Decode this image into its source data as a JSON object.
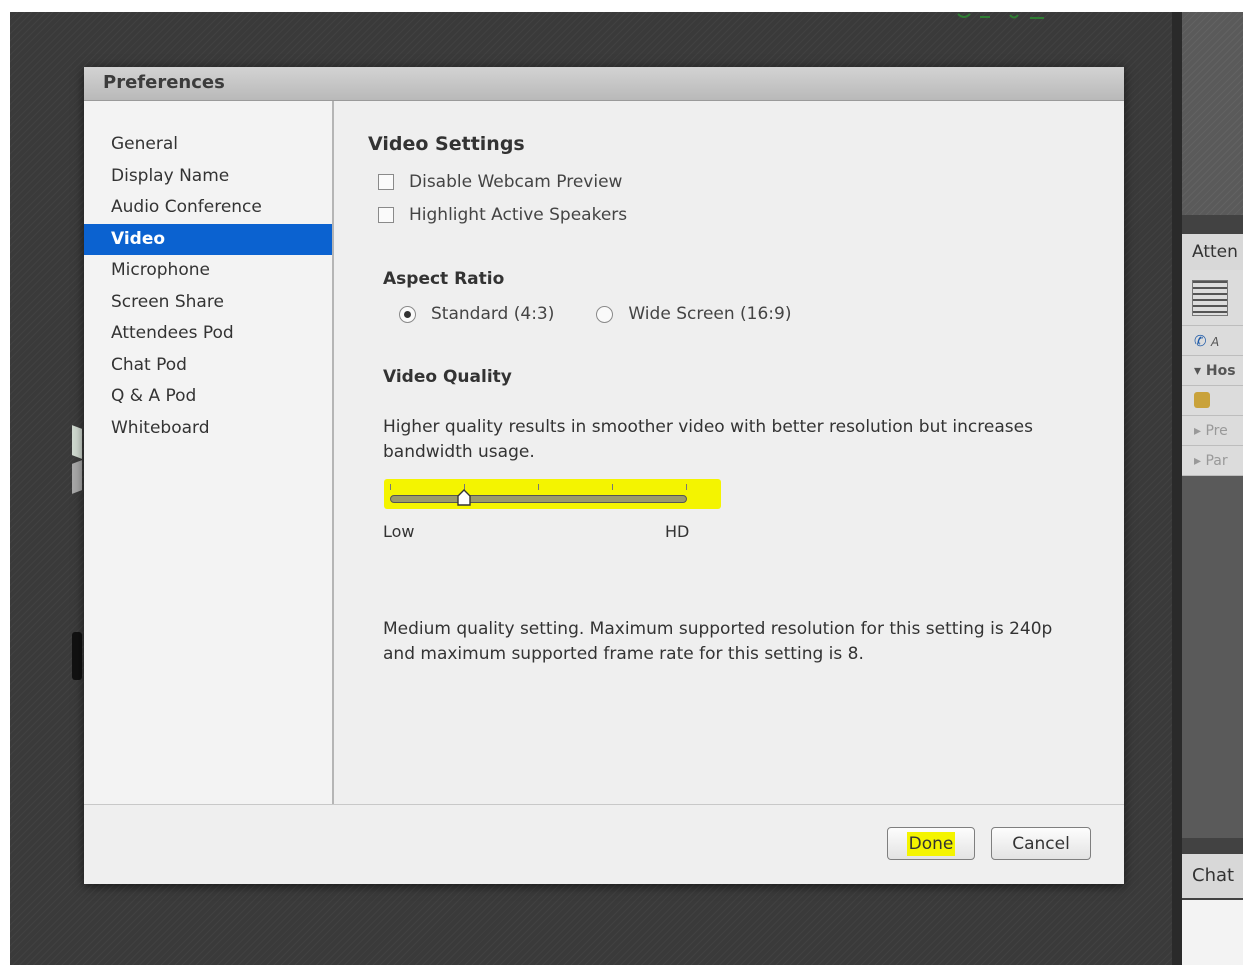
{
  "dialog": {
    "title": "Preferences"
  },
  "sidebar": {
    "items": [
      {
        "label": "General",
        "active": false
      },
      {
        "label": "Display Name",
        "active": false
      },
      {
        "label": "Audio Conference",
        "active": false
      },
      {
        "label": "Video",
        "active": true
      },
      {
        "label": "Microphone",
        "active": false
      },
      {
        "label": "Screen Share",
        "active": false
      },
      {
        "label": "Attendees Pod",
        "active": false
      },
      {
        "label": "Chat Pod",
        "active": false
      },
      {
        "label": "Q & A Pod",
        "active": false
      },
      {
        "label": "Whiteboard",
        "active": false
      }
    ]
  },
  "video_settings": {
    "heading": "Video Settings",
    "checkboxes": [
      {
        "label": "Disable Webcam Preview",
        "checked": false
      },
      {
        "label": "Highlight Active Speakers",
        "checked": false
      }
    ],
    "aspect_ratio": {
      "heading": "Aspect Ratio",
      "options": [
        {
          "label": "Standard (4:3)",
          "selected": true
        },
        {
          "label": "Wide Screen (16:9)",
          "selected": false
        }
      ]
    },
    "video_quality": {
      "heading": "Video Quality",
      "description": "Higher quality results in smoother video with better resolution but increases bandwidth usage.",
      "slider": {
        "min_label": "Low",
        "max_label": "HD",
        "steps": 5,
        "value_index": 1
      },
      "status": "Medium quality setting. Maximum supported resolution for this setting is 240p and maximum supported frame rate for this setting is 8."
    }
  },
  "footer": {
    "done_label": "Done",
    "cancel_label": "Cancel"
  },
  "background_panel": {
    "attendees_header": "Atten",
    "row_host": "▾ Hos",
    "row_presenters": "▸ Pre",
    "row_participants": "▸ Par",
    "row_audio": "A",
    "chat_header": "Chat"
  },
  "colors": {
    "accent": "#0b62d0",
    "highlight": "#f4f400",
    "backdrop": "#3a3a3a",
    "dialog_bg": "#efefef"
  },
  "icons": {
    "phone": "phone-icon",
    "user": "user-icon",
    "list": "list-icon"
  }
}
